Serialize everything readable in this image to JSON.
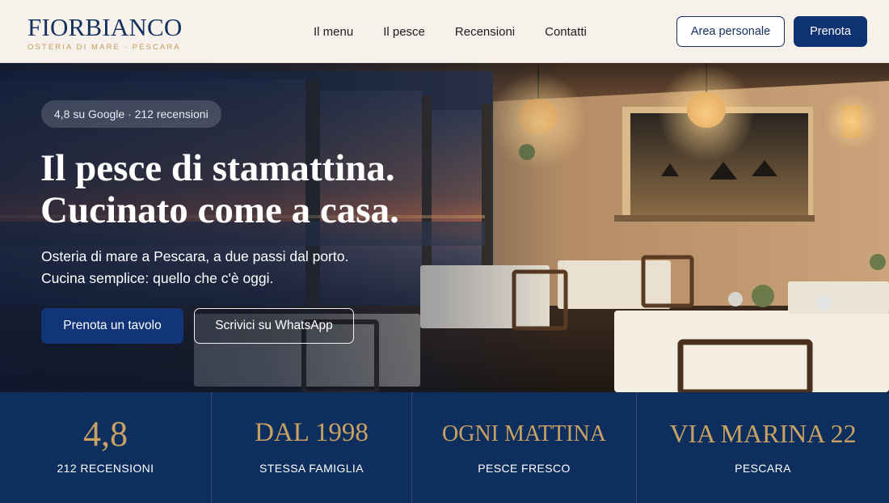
{
  "brand": {
    "name": "FIORBIANCO",
    "tagline": "OSTERIA DI MARE · PESCARA",
    "color": "#14305e",
    "accent": "#c39a5a"
  },
  "nav": {
    "items": [
      {
        "label": "Il menu"
      },
      {
        "label": "Il pesce"
      },
      {
        "label": "Recensioni"
      },
      {
        "label": "Contatti"
      }
    ]
  },
  "header_actions": {
    "personal_area": "Area personale",
    "book": "Prenota"
  },
  "hero": {
    "rating_badge": "4,8 su Google · 212 recensioni",
    "title_line1": "Il pesce di stamattina.",
    "title_line2": "Cucinato come a casa.",
    "subtitle_line1": "Osteria di mare a Pescara, a due passi dal porto.",
    "subtitle_line2": "Cucina semplice: quello che c'è oggi.",
    "cta_primary": "Prenota un tavolo",
    "cta_secondary": "Scrivici su WhatsApp",
    "primary_color": "#12357a"
  },
  "stats": [
    {
      "value": "4,8",
      "label": "212 RECENSIONI"
    },
    {
      "value": "DAL 1998",
      "label": "STESSA FAMIGLIA"
    },
    {
      "value": "OGNI MATTINA",
      "label": "PESCE FRESCO"
    },
    {
      "value": "VIA MARINA 22",
      "label": "PESCARA"
    }
  ],
  "stats_colors": {
    "background": "#0e2f5e",
    "value": "#c9a263"
  }
}
